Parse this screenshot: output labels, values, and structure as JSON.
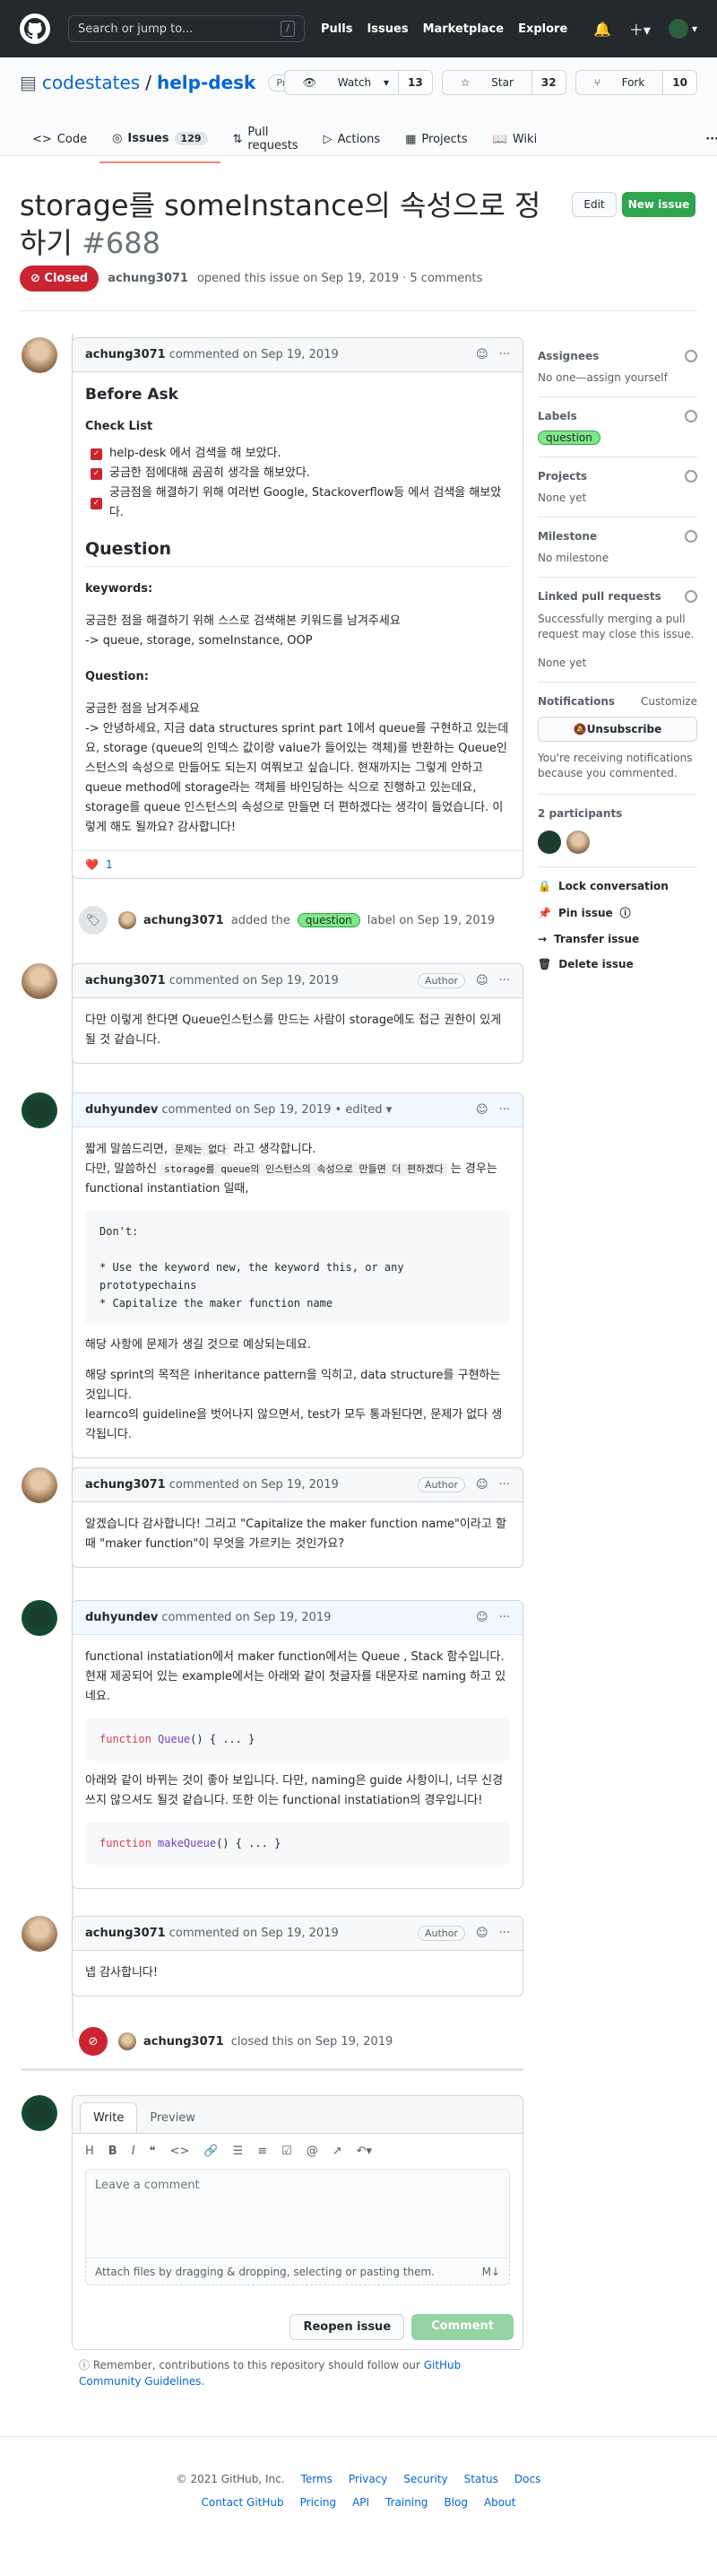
{
  "header": {
    "search_placeholder": "Search or jump to...",
    "search_key": "/",
    "nav": [
      "Pulls",
      "Issues",
      "Marketplace",
      "Explore"
    ]
  },
  "repo": {
    "owner": "codestates",
    "sep": "/",
    "name": "help-desk",
    "visibility": "Private",
    "watch": {
      "label": "Watch",
      "count": "13"
    },
    "star": {
      "label": "Star",
      "count": "32"
    },
    "fork": {
      "label": "Fork",
      "count": "10"
    },
    "tabs": [
      {
        "label": "Code"
      },
      {
        "label": "Issues",
        "count": "129"
      },
      {
        "label": "Pull requests"
      },
      {
        "label": "Actions"
      },
      {
        "label": "Projects"
      },
      {
        "label": "Wiki"
      }
    ]
  },
  "issue": {
    "title": "storage를 someInstance의 속성으로 정하기",
    "number": "#688",
    "edit": "Edit",
    "new_issue": "New issue",
    "status": "Closed",
    "author": "achung3071",
    "meta": "opened this issue on Sep 19, 2019 · 5 comments"
  },
  "c1": {
    "author": "achung3071",
    "meta": "commented on Sep 19, 2019",
    "h_before": "Before Ask",
    "h_check": "Check List",
    "checks": [
      "help-desk 에서 검색을 해 보았다.",
      "궁금한 점에대해 곰곰히 생각을 해보았다.",
      "궁금점을 해결하기 위해 여러번 Google, Stackoverflow등 에서 검색을 해보았다."
    ],
    "h_question": "Question",
    "h_keywords": "keywords:",
    "kw1": "궁금한 점을 해결하기 위해 스스로 검색해본 키워드를 남겨주세요",
    "kw2": "-> queue, storage, someInstance, OOP",
    "h_q": "Question:",
    "q1": "궁금한 점을 남겨주세요",
    "q2": "-> 안녕하세요, 지금 data structures sprint part 1에서 queue를 구현하고 있는데요, storage (queue의 인덱스 값이랑 value가 들어있는 객체)를 반환하는 Queue인스턴스의 속성으로 만들어도 되는지 여쭤보고 싶습니다. 현재까지는 그렇게 안하고 queue method에 storage라는 객체를 바인딩하는 식으로 진행하고 있는데요, storage를 queue 인스턴스의 속성으로 만들면 더 편하겠다는 생각이 들었습니다. 이렇게 해도 될까요? 감사합니다!",
    "reaction": "❤️",
    "reaction_count": "1"
  },
  "ev1": {
    "user": "achung3071",
    "pre": "added the",
    "label": "question",
    "post": "label on Sep 19, 2019"
  },
  "c2": {
    "author": "achung3071",
    "meta": "commented on Sep 19, 2019",
    "badge": "Author",
    "body": "다만 이렇게 한다면 Queue인스턴스를 만드는 사람이 storage에도 접근 권한이 있게 될 것 같습니다."
  },
  "c3": {
    "author": "duhyundev",
    "meta": "commented on Sep 19, 2019",
    "edited": "• edited ▾",
    "l1": "짧게 말씀드리면,",
    "l1b": "문제는 없다",
    "l1c": "라고 생각합니다.",
    "l2": "다만, 말씀하신",
    "l2b": "storage를 queue의 인스턴스의 속성으로 만들면 더 편하겠다",
    "l2c": "는 경우는",
    "l3": "functional instantiation 일때,",
    "code": [
      "Don't:",
      "",
      "* Use the keyword new, the keyword this, or any prototypechains",
      "* Capitalize the maker function name"
    ],
    "p1": "해당 사항에 문제가 생길 것으로 예상되는데요.",
    "p2": "해당 sprint의 목적은 inheritance pattern을 익히고, data structure를 구현하는 것입니다.",
    "p3": "learnco의 guideline을 벗어나지 않으면서, test가 모두 통과된다면, 문제가 없다 생각됩니다."
  },
  "c4": {
    "author": "achung3071",
    "meta": "commented on Sep 19, 2019",
    "badge": "Author",
    "body": "알겠습니다 감사합니다! 그리고 \"Capitalize the maker function name\"이라고 할 때 \"maker function\"이 무엇을 가르키는 것인가요?"
  },
  "c5": {
    "author": "duhyundev",
    "meta": "commented on Sep 19, 2019",
    "p1": "functional instatiation에서 maker function에서는 Queue , Stack 함수입니다. 현재 제공되어 있는 example에서는 아래와 같이 첫글자를 대문자로 naming 하고 있네요.",
    "code1_kw": "function",
    "code1_name": "Queue",
    "code1_rest": "() { ... }",
    "p2": "아래와 같이 바뀌는 것이 좋아 보입니다. 다만, naming은 guide 사항이니, 너무 신경쓰지 않으셔도 될것 같습니다. 또한 이는 functional instatiation의 경우입니다!",
    "code2_kw": "function",
    "code2_name": "makeQueue",
    "code2_rest": "() { ... }"
  },
  "c6": {
    "author": "achung3071",
    "meta": "commented on Sep 19, 2019",
    "badge": "Author",
    "body": "넵 감사합니다!"
  },
  "ev2": {
    "user": "achung3071",
    "text": "closed this on Sep 19, 2019"
  },
  "editor": {
    "tab_write": "Write",
    "tab_preview": "Preview",
    "placeholder": "Leave a comment",
    "attach": "Attach files by dragging & dropping, selecting or pasting them.",
    "reopen": "Reopen issue",
    "comment": "Comment"
  },
  "note": {
    "text": "Remember, contributions to this repository should follow our",
    "link": "GitHub Community Guidelines",
    "end": "."
  },
  "sidebar": {
    "assignees": "Assignees",
    "assignees_val": "No one—assign yourself",
    "labels": "Labels",
    "label_val": "question",
    "projects": "Projects",
    "projects_val": "None yet",
    "milestone": "Milestone",
    "milestone_val": "No milestone",
    "linked": "Linked pull requests",
    "linked_desc": "Successfully merging a pull request may close this issue.",
    "linked_val": "None yet",
    "notifications": "Notifications",
    "customize": "Customize",
    "unsubscribe": "Unsubscribe",
    "notif_desc": "You're receiving notifications because you commented.",
    "participants": "2 participants",
    "lock": "Lock conversation",
    "pin": "Pin issue",
    "transfer": "Transfer issue",
    "delete": "Delete issue"
  },
  "footer": {
    "copy": "© 2021 GitHub, Inc.",
    "row1": [
      "Terms",
      "Privacy",
      "Security",
      "Status",
      "Docs"
    ],
    "row2": [
      "Contact GitHub",
      "Pricing",
      "API",
      "Training",
      "Blog",
      "About"
    ]
  }
}
